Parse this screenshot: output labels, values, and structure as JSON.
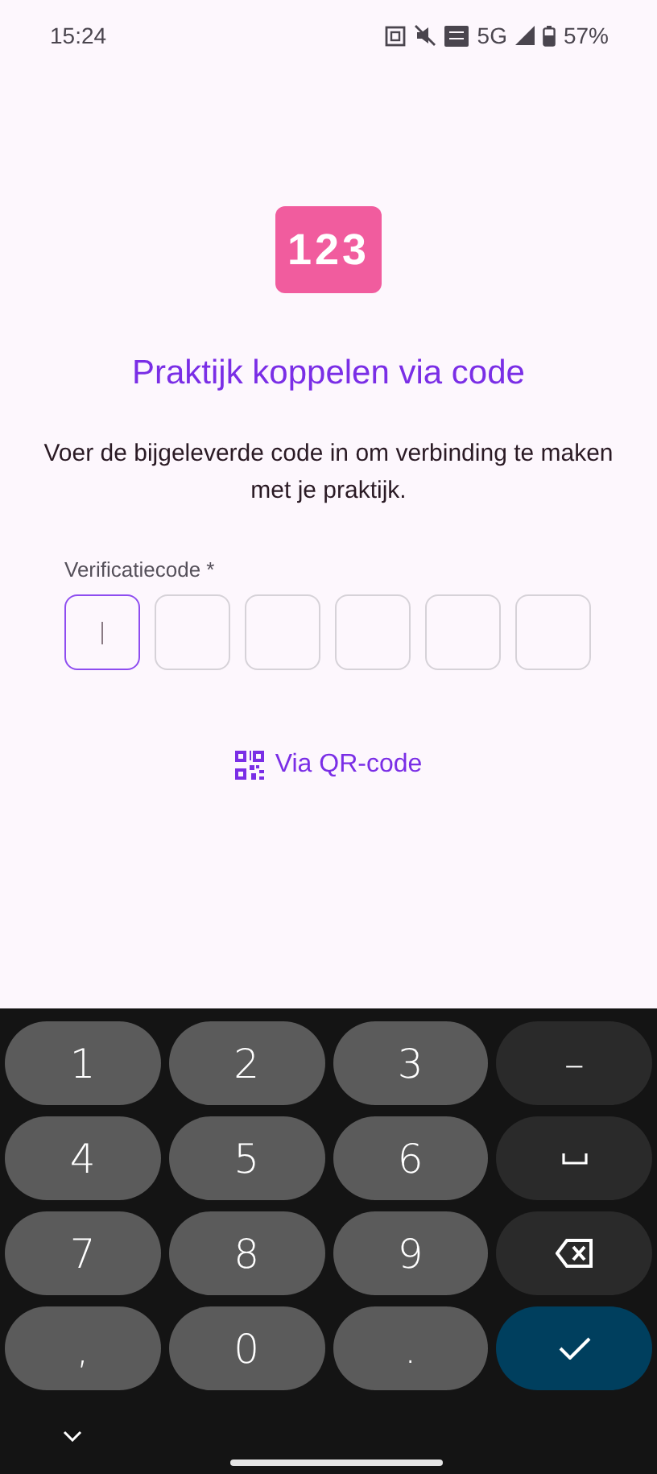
{
  "status_bar": {
    "time": "15:24",
    "network": "5G",
    "battery": "57%"
  },
  "logo": {
    "text": "123"
  },
  "title": "Praktijk koppelen via code",
  "description": "Voer de bijgeleverde code in om verbinding te maken met je praktijk.",
  "code_field": {
    "label": "Verificatiecode *",
    "boxes": [
      {
        "focused": true
      },
      {
        "focused": false
      },
      {
        "focused": false
      },
      {
        "focused": false
      },
      {
        "focused": false
      },
      {
        "focused": false
      }
    ]
  },
  "qr_link": "Via QR-code",
  "keyboard": {
    "keys": [
      {
        "kind": "digit",
        "label": "1"
      },
      {
        "kind": "digit",
        "label": "2"
      },
      {
        "kind": "digit",
        "label": "3"
      },
      {
        "kind": "symbol",
        "label": "–"
      },
      {
        "kind": "digit",
        "label": "4"
      },
      {
        "kind": "digit",
        "label": "5"
      },
      {
        "kind": "digit",
        "label": "6"
      },
      {
        "kind": "space"
      },
      {
        "kind": "digit",
        "label": "7"
      },
      {
        "kind": "digit",
        "label": "8"
      },
      {
        "kind": "digit",
        "label": "9"
      },
      {
        "kind": "backspace"
      },
      {
        "kind": "digit",
        "label": ","
      },
      {
        "kind": "digit",
        "label": "0"
      },
      {
        "kind": "digit",
        "label": "."
      },
      {
        "kind": "enter"
      }
    ]
  }
}
